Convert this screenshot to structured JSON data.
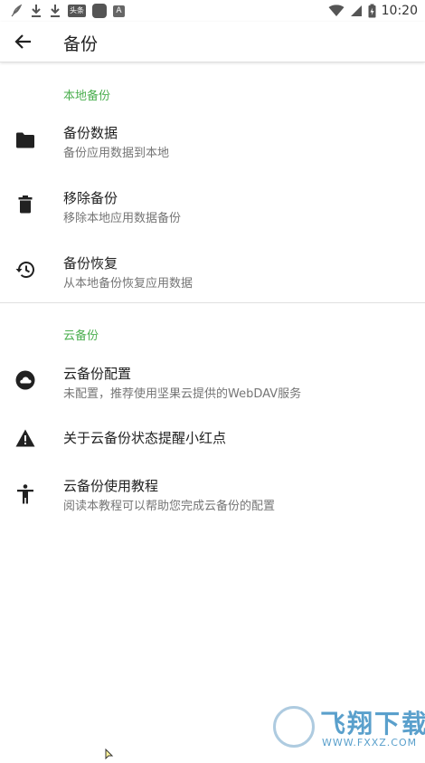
{
  "status_bar": {
    "time": "10:20",
    "badge_a": "A",
    "badge_news": "头条"
  },
  "toolbar": {
    "title": "备份"
  },
  "sections": {
    "local": {
      "header": "本地备份",
      "items": [
        {
          "title": "备份数据",
          "subtitle": "备份应用数据到本地",
          "icon": "folder-icon"
        },
        {
          "title": "移除备份",
          "subtitle": "移除本地应用数据备份",
          "icon": "trash-icon"
        },
        {
          "title": "备份恢复",
          "subtitle": "从本地备份恢复应用数据",
          "icon": "restore-history-icon"
        }
      ]
    },
    "cloud": {
      "header": "云备份",
      "items": [
        {
          "title": "云备份配置",
          "subtitle": "未配置，推荐使用坚果云提供的WebDAV服务",
          "icon": "cloud-icon"
        },
        {
          "title": "关于云备份状态提醒小红点",
          "icon": "warning-icon"
        },
        {
          "title": "云备份使用教程",
          "subtitle": "阅读本教程可以帮助您完成云备份的配置",
          "icon": "accessibility-icon"
        }
      ]
    }
  },
  "watermark": {
    "text": "飞翔下载",
    "url": "WWW.FXXZ.COM"
  },
  "colors": {
    "accent": "#4caf50",
    "text_primary": "#212121",
    "text_secondary": "#757575",
    "divider": "#e0e0e0"
  }
}
